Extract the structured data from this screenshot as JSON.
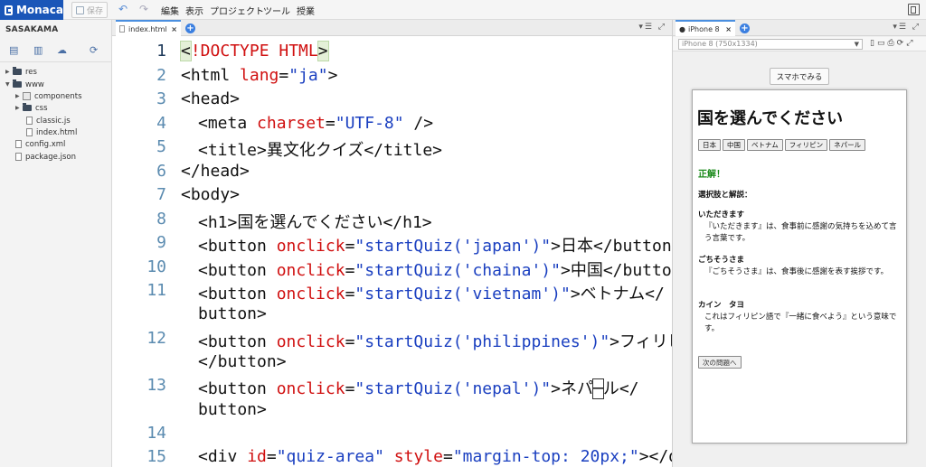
{
  "app": {
    "logo": "Monaca",
    "save_label": "保存",
    "menus": [
      "編集",
      "表示",
      "プロジェクト",
      "ツール",
      "授業"
    ]
  },
  "sidebar": {
    "project_title": "SASAKAMA",
    "tree": [
      {
        "label": "res",
        "type": "folder",
        "depth": 0,
        "expanded": false
      },
      {
        "label": "www",
        "type": "folder",
        "depth": 0,
        "expanded": true
      },
      {
        "label": "components",
        "type": "folder-box",
        "depth": 1,
        "expanded": false
      },
      {
        "label": "css",
        "type": "folder",
        "depth": 1,
        "expanded": false
      },
      {
        "label": "classic.js",
        "type": "file",
        "depth": 2
      },
      {
        "label": "index.html",
        "type": "file",
        "depth": 2
      },
      {
        "label": "config.xml",
        "type": "file",
        "depth": 0
      },
      {
        "label": "package.json",
        "type": "file",
        "depth": 0
      }
    ]
  },
  "editor": {
    "tab_label": "index.html",
    "line_numbers": [
      "1",
      "2",
      "3",
      "4",
      "5",
      "6",
      "7",
      "8",
      "9",
      "10",
      "11",
      "12",
      "13",
      "14",
      "15"
    ],
    "current_line": "1"
  },
  "code": {
    "l1a": "<",
    "l1b": "!DOCTYPE",
    "l1c": " HTML",
    "l1d": ">",
    "l2a": "<html ",
    "l2b": "lang",
    "l2c": "=",
    "l2d": "\"ja\"",
    "l2e": ">",
    "l3": "<head>",
    "l4a": "<meta ",
    "l4b": "charset",
    "l4c": "=",
    "l4d": "\"UTF-8\"",
    "l4e": " />",
    "l5": "<title>異文化クイズ</title>",
    "l6": "</head>",
    "l7": "<body>",
    "l8": "<h1>国を選んでください</h1>",
    "l9a": "<button ",
    "l9b": "onclick",
    "l9c": "=",
    "l9d": "\"startQuiz('japan')\"",
    "l9e": ">日本</button>",
    "l10a": "<button ",
    "l10b": "onclick",
    "l10c": "=",
    "l10d": "\"startQuiz('chaina')\"",
    "l10e": ">中国</button>",
    "l11a": "<button ",
    "l11b": "onclick",
    "l11c": "=",
    "l11d": "\"startQuiz('vietnam')\"",
    "l11e": ">ベトナム</",
    "l11f": "button>",
    "l12a": "<button ",
    "l12b": "onclick",
    "l12c": "=",
    "l12d": "\"startQuiz('philippines')\"",
    "l12e": ">フィリピン",
    "l12f": "</button>",
    "l13a": "<button ",
    "l13b": "onclick",
    "l13c": "=",
    "l13d": "\"startQuiz('nepal')\"",
    "l13e": ">ネパ",
    "l13m": "─",
    "l13g": "ル</",
    "l13f": "button>",
    "l15a": "<div ",
    "l15b": "id",
    "l15c": "=",
    "l15d": "\"quiz-area\"",
    "l15e": " ",
    "l15f": "style",
    "l15g": "=",
    "l15h": "\"margin-top: 20px;\"",
    "l15i": "></div>"
  },
  "preview": {
    "tab_label": "iPhone 8",
    "device": "iPhone 8 (750x1334)",
    "smartphone_button": "スマホでみる",
    "heading": "国を選んでください",
    "country_buttons": [
      "日本",
      "中国",
      "ベトナム",
      "フィリピン",
      "ネパール"
    ],
    "result": "正解！",
    "explain_title": "選択肢と解説：",
    "items": [
      {
        "term": "いただきます",
        "desc": "『いただきます』は、食事前に感謝の気持ちを込めて言う言葉です。"
      },
      {
        "term": "ごちそうさま",
        "desc": "『ごちそうさま』は、食事後に感謝を表す挨拶です。"
      },
      {
        "term": "カイン　タヨ",
        "desc": "これはフィリピン語で『一緒に食べよう』という意味です。"
      }
    ],
    "next_button": "次の問題へ"
  }
}
